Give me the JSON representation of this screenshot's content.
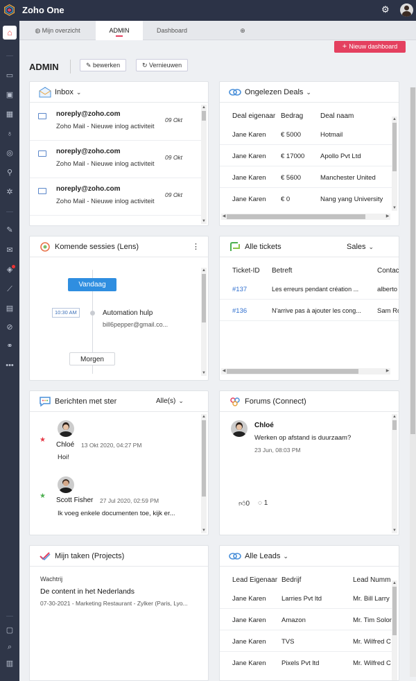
{
  "app": {
    "title": "Zoho One"
  },
  "tabs": [
    {
      "label": "Mijn overzicht"
    },
    {
      "label": "ADMIN"
    },
    {
      "label": "Dashboard"
    }
  ],
  "toolbar": {
    "new_dashboard": "Nieuw dashboard",
    "page_title": "ADMIN",
    "edit": "bewerken",
    "refresh": "Vernieuwen"
  },
  "inbox": {
    "title": "Inbox",
    "items": [
      {
        "from": "noreply@zoho.com",
        "subject": "Zoho Mail - Nieuwe inlog activiteit",
        "date": "09 Okt"
      },
      {
        "from": "noreply@zoho.com",
        "subject": "Zoho Mail - Nieuwe inlog activiteit",
        "date": "09 Okt"
      },
      {
        "from": "noreply@zoho.com",
        "subject": "Zoho Mail - Nieuwe inlog activiteit",
        "date": "09 Okt"
      }
    ]
  },
  "deals": {
    "title": "Ongelezen Deals",
    "columns": [
      "Deal eigenaar",
      "Bedrag",
      "Deal naam"
    ],
    "rows": [
      [
        "Jane Karen",
        "€ 5000",
        "Hotmail"
      ],
      [
        "Jane Karen",
        "€ 17000",
        "Apollo Pvt Ltd"
      ],
      [
        "Jane Karen",
        "€ 5600",
        "Manchester United"
      ],
      [
        "Jane Karen",
        "€ 0",
        "Nang yang University"
      ]
    ]
  },
  "sessions": {
    "title": "Komende sessies (Lens)",
    "today": "Vandaag",
    "time": "10:30 AM",
    "event_title": "Automation hulp",
    "event_email": "bill6pepper@gmail.co...",
    "tomorrow": "Morgen"
  },
  "tickets": {
    "title": "Alle tickets",
    "filter": "Sales",
    "columns": [
      "Ticket-ID",
      "Betreft",
      "Contac"
    ],
    "rows": [
      [
        "#137",
        "Les erreurs pendant création ...",
        "alberto"
      ],
      [
        "#136",
        "N'arrive pas à ajouter les cong...",
        "Sam Ro"
      ]
    ]
  },
  "starred": {
    "title": "Berichten met ster",
    "filter": "Alle(s)",
    "items": [
      {
        "name": "Chloé",
        "time": "13 Okt 2020, 04:27 PM",
        "text": "Hoi!",
        "star_color": "#e63946"
      },
      {
        "name": "Scott Fisher",
        "time": "27 Jul 2020, 02:59 PM",
        "text": "Ik voeg enkele documenten toe, kijk er...",
        "star_color": "#4caf50"
      }
    ]
  },
  "forums": {
    "title": "Forums (Connect)",
    "name": "Chloé",
    "text": "Werken op afstand is duurzaam?",
    "date": "23 Jun, 08:03 PM",
    "likes": "0",
    "comments": "1"
  },
  "tasks": {
    "title": "Mijn taken (Projects)",
    "section": "Wachtrij",
    "task": "De content in het Nederlands",
    "meta": "07-30-2021 - Marketing Restaurant - Zylker (Paris, Lyo..."
  },
  "leads": {
    "title": "Alle Leads",
    "columns": [
      "Lead Eigenaar",
      "Bedrijf",
      "Lead Numm"
    ],
    "rows": [
      [
        "Jane Karen",
        "Larries Pvt ltd",
        "Mr. Bill Larry"
      ],
      [
        "Jane Karen",
        "Amazon",
        "Mr. Tim Solon"
      ],
      [
        "Jane Karen",
        "TVS",
        "Mr. Wilfred C"
      ],
      [
        "Jane Karen",
        "Pixels Pvt ltd",
        "Mr. Wilfred C"
      ]
    ]
  },
  "colors": {
    "accent": "#e4405f",
    "sidebar": "#2f3648",
    "topbar": "#2c3347",
    "link": "#2f6fcf",
    "badge": "#2f8ee0"
  }
}
